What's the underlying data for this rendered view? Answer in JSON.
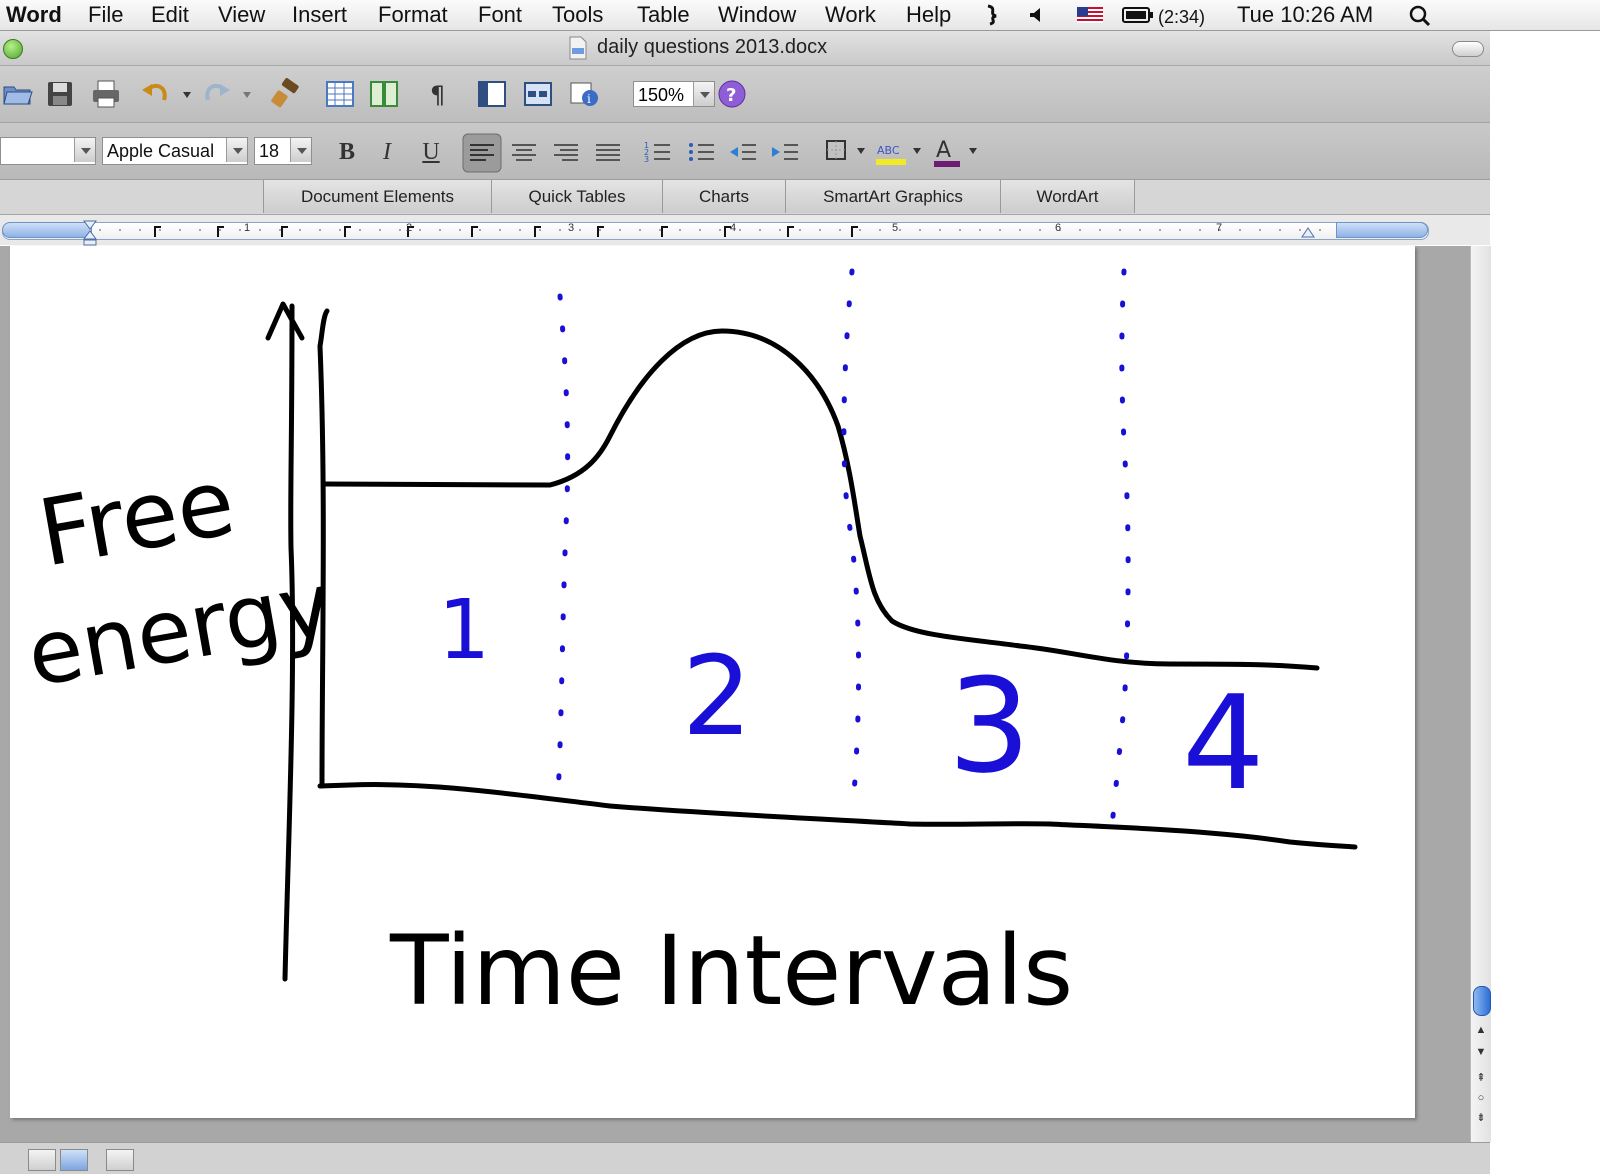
{
  "menubar": {
    "app": "Word",
    "items": [
      "File",
      "Edit",
      "View",
      "Insert",
      "Format",
      "Font",
      "Tools",
      "Table",
      "Window",
      "Work",
      "Help"
    ],
    "battery": "(2:34)",
    "clock": "Tue 10:26 AM"
  },
  "window": {
    "title": "daily questions 2013.docx"
  },
  "toolbar": {
    "zoom": "150%"
  },
  "format": {
    "style_value": "",
    "font": "Apple Casual",
    "size": "18",
    "bold": "B",
    "italic": "I",
    "underline": "U",
    "highlight_label": "ABC",
    "font_color_label": "A"
  },
  "ribbon": {
    "tabs": [
      "Document Elements",
      "Quick Tables",
      "Charts",
      "SmartArt Graphics",
      "WordArt"
    ]
  },
  "ruler": {
    "numbers": [
      "1",
      "2",
      "3",
      "4",
      "5",
      "6",
      "7"
    ]
  },
  "drawing": {
    "ylabel_line1": "Free",
    "ylabel_line2": "energy",
    "xlabel": "Time Intervals",
    "intervals": [
      "1",
      "2",
      "3",
      "4"
    ],
    "ink_black": "#000000",
    "ink_blue": "#1a0fd6"
  }
}
